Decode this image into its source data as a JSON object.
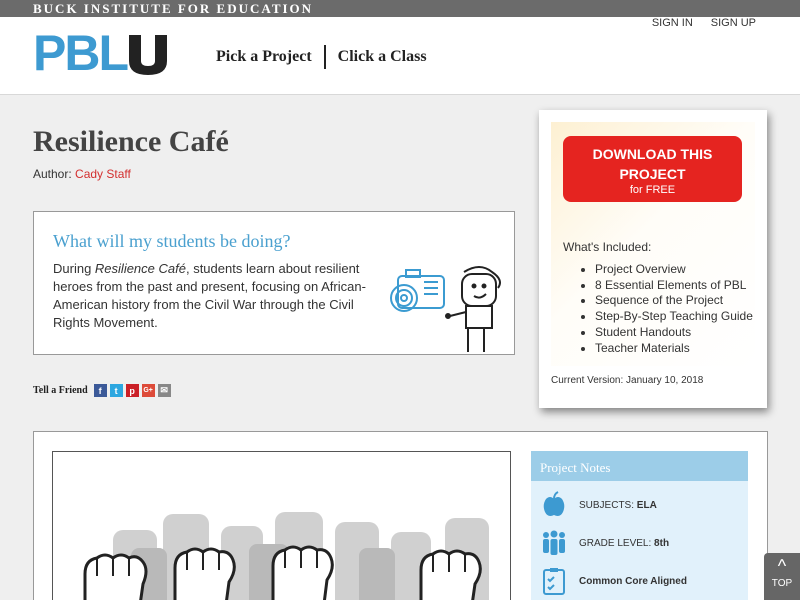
{
  "topbar": {
    "org": "BUCK INSTITUTE FOR EDUCATION"
  },
  "header": {
    "logo": {
      "pbl": "PBL",
      "u": "U"
    },
    "nav": [
      "Pick a Project",
      "Click a Class"
    ],
    "auth": {
      "sign_in": "SIGN IN",
      "sign_up": "SIGN UP"
    }
  },
  "project": {
    "title": "Resilience Café",
    "author_label": "Author:",
    "author_name": "Cady Staff"
  },
  "doing": {
    "heading": "What will my students be doing?",
    "text_pre": "During ",
    "text_em": "Resilience Café",
    "text_post": ", students learn about resilient heroes from the past and present, focusing on African-American history from the Civil War through the Civil Rights Movement."
  },
  "tell": {
    "label": "Tell a Friend",
    "icons": [
      {
        "name": "facebook-icon",
        "glyph": "f",
        "color": "#3b5998"
      },
      {
        "name": "twitter-icon",
        "glyph": "t",
        "color": "#2da7e0"
      },
      {
        "name": "pinterest-icon",
        "glyph": "p",
        "color": "#cb2027"
      },
      {
        "name": "googleplus-icon",
        "glyph": "G+",
        "color": "#dd4b39"
      },
      {
        "name": "email-icon",
        "glyph": "✉",
        "color": "#888888"
      }
    ]
  },
  "download": {
    "title": "DOWNLOAD THIS PROJECT",
    "subtitle": "for FREE",
    "included_label": "What's Included:",
    "included": [
      "Project Overview",
      "8 Essential Elements of PBL",
      "Sequence of the Project",
      "Step-By-Step Teaching Guide",
      "Student Handouts",
      "Teacher Materials"
    ],
    "version": "Current Version: January 10, 2018"
  },
  "notes": {
    "heading": "Project Notes",
    "subjects_label": "SUBJECTS:",
    "subjects_value": "ELA",
    "grade_label": "GRADE LEVEL:",
    "grade_value": "8th",
    "common_core": "Common Core Aligned"
  },
  "top_button": {
    "caret": "^",
    "label": "TOP"
  },
  "colors": {
    "accent_blue": "#3d9ad1",
    "download_red": "#e52420",
    "author_red": "#d32f2f"
  }
}
